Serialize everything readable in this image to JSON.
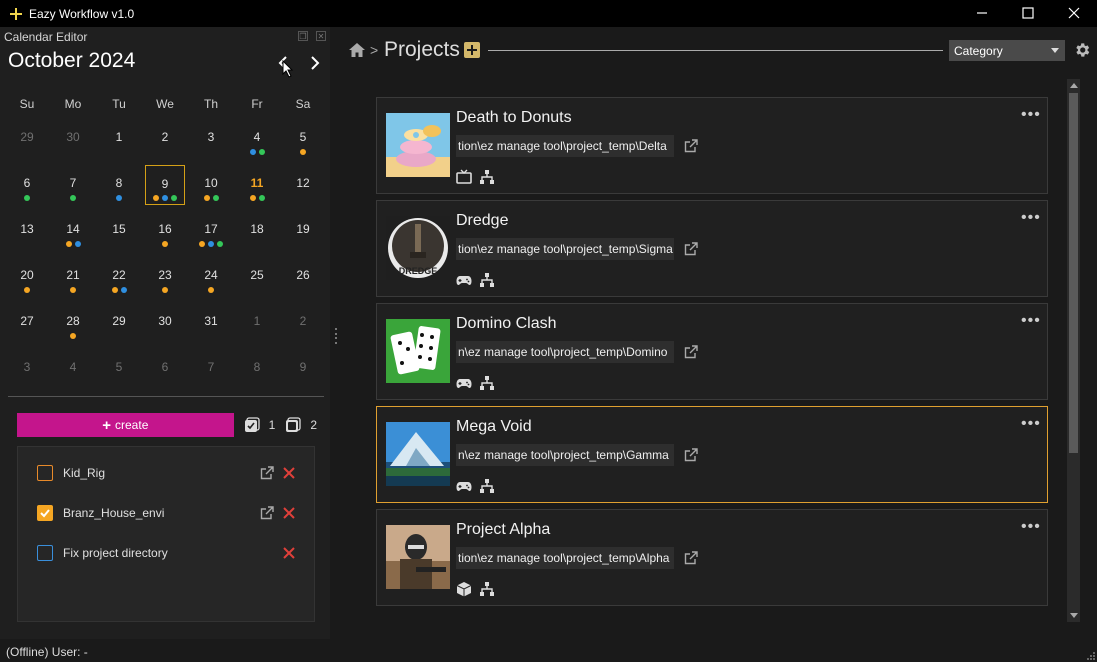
{
  "app": {
    "title": "Eazy Workflow v1.0"
  },
  "calendar": {
    "panel_title": "Calendar Editor",
    "month_title": "October 2024",
    "weekdays": [
      "Su",
      "Mo",
      "Tu",
      "We",
      "Th",
      "Fr",
      "Sa"
    ],
    "days": [
      {
        "n": "29",
        "muted": true,
        "dots": []
      },
      {
        "n": "30",
        "muted": true,
        "dots": []
      },
      {
        "n": "1",
        "dots": []
      },
      {
        "n": "2",
        "dots": []
      },
      {
        "n": "3",
        "dots": []
      },
      {
        "n": "4",
        "dots": [
          "#2f8fe0",
          "#34c759"
        ]
      },
      {
        "n": "5",
        "dots": [
          "#f5a623"
        ]
      },
      {
        "n": "6",
        "dots": [
          "#34c759"
        ]
      },
      {
        "n": "7",
        "dots": [
          "#34c759"
        ]
      },
      {
        "n": "8",
        "dots": [
          "#2f8fe0"
        ]
      },
      {
        "n": "9",
        "today": true,
        "dots": [
          "#f5a623",
          "#2f8fe0",
          "#34c759"
        ]
      },
      {
        "n": "10",
        "dots": [
          "#f5a623",
          "#34c759"
        ]
      },
      {
        "n": "11",
        "highlight": true,
        "dots": [
          "#f5a623",
          "#34c759"
        ]
      },
      {
        "n": "12",
        "dots": []
      },
      {
        "n": "13",
        "dots": []
      },
      {
        "n": "14",
        "dots": [
          "#f5a623",
          "#2f8fe0"
        ]
      },
      {
        "n": "15",
        "dots": []
      },
      {
        "n": "16",
        "dots": [
          "#f5a623"
        ]
      },
      {
        "n": "17",
        "dots": [
          "#f5a623",
          "#2f8fe0",
          "#34c759"
        ]
      },
      {
        "n": "18",
        "dots": []
      },
      {
        "n": "19",
        "dots": []
      },
      {
        "n": "20",
        "dots": [
          "#f5a623"
        ]
      },
      {
        "n": "21",
        "dots": [
          "#f5a623"
        ]
      },
      {
        "n": "22",
        "dots": [
          "#f5a623",
          "#2f8fe0"
        ]
      },
      {
        "n": "23",
        "dots": [
          "#f5a623"
        ]
      },
      {
        "n": "24",
        "dots": [
          "#f5a623"
        ]
      },
      {
        "n": "25",
        "dots": []
      },
      {
        "n": "26",
        "dots": []
      },
      {
        "n": "27",
        "dots": []
      },
      {
        "n": "28",
        "dots": [
          "#f5a623"
        ]
      },
      {
        "n": "29",
        "dots": []
      },
      {
        "n": "30",
        "dots": []
      },
      {
        "n": "31",
        "dots": []
      },
      {
        "n": "1",
        "muted": true,
        "dots": []
      },
      {
        "n": "2",
        "muted": true,
        "dots": []
      },
      {
        "n": "3",
        "muted": true,
        "dots": []
      },
      {
        "n": "4",
        "muted": true,
        "dots": []
      },
      {
        "n": "5",
        "muted": true,
        "dots": []
      },
      {
        "n": "6",
        "muted": true,
        "dots": []
      },
      {
        "n": "7",
        "muted": true,
        "dots": []
      },
      {
        "n": "8",
        "muted": true,
        "dots": []
      },
      {
        "n": "9",
        "muted": true,
        "dots": []
      }
    ]
  },
  "tasks": {
    "create_label": "create",
    "checked_count": "1",
    "unchecked_count": "2",
    "items": [
      {
        "label": "Kid_Rig",
        "state": "orange",
        "link": true
      },
      {
        "label": "Branz_House_envi",
        "state": "checked",
        "link": true
      },
      {
        "label": "Fix project directory",
        "state": "blue",
        "link": false
      }
    ]
  },
  "status": {
    "text": "(Offline) User: -"
  },
  "projects": {
    "breadcrumb_title": "Projects",
    "breadcrumb_sep": ">",
    "category_selected": "Category",
    "items": [
      {
        "name": "Death to Donuts",
        "path": "tion\\ez manage tool\\project_temp\\Delta",
        "type_icon": "tv-icon",
        "thumb": "donuts"
      },
      {
        "name": "Dredge",
        "path": "tion\\ez manage tool\\project_temp\\Sigma",
        "type_icon": "gamepad-icon",
        "thumb": "dredge",
        "thumb_text": "DREDGE"
      },
      {
        "name": "Domino Clash",
        "path": "n\\ez manage tool\\project_temp\\Domino",
        "type_icon": "gamepad-icon",
        "thumb": "domino"
      },
      {
        "name": "Mega Void",
        "path": "n\\ez manage tool\\project_temp\\Gamma",
        "type_icon": "gamepad-icon",
        "thumb": "mountain",
        "selected": true
      },
      {
        "name": "Project Alpha",
        "path": "tion\\ez manage tool\\project_temp\\Alpha",
        "type_icon": "box-icon",
        "thumb": "soldier"
      }
    ]
  },
  "colors": {
    "accent_magenta": "#c4158c",
    "selected_border": "#e0a030",
    "dot_orange": "#f5a623",
    "dot_blue": "#2f8fe0",
    "dot_green": "#34c759"
  }
}
